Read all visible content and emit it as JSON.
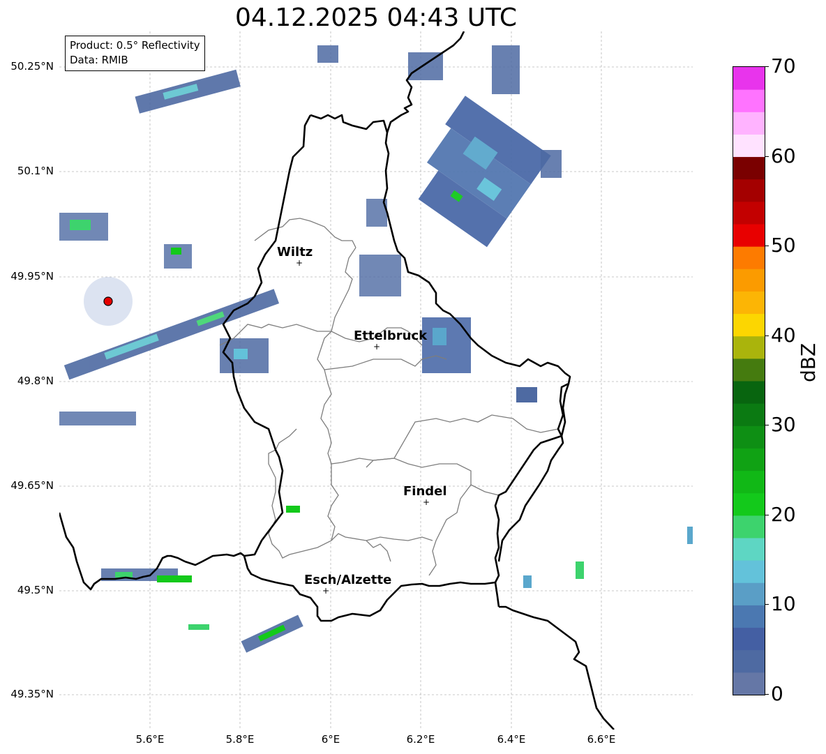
{
  "title": "04.12.2025 04:43 UTC",
  "infobox": {
    "product": "Product: 0.5° Reflectivity",
    "data": "Data: RMIB"
  },
  "axes": {
    "y_ticks": [
      "50.25°N",
      "50.1°N",
      "49.95°N",
      "49.8°N",
      "49.65°N",
      "49.5°N",
      "49.35°N"
    ],
    "x_ticks": [
      "5.6°E",
      "5.8°E",
      "6°E",
      "6.2°E",
      "6.4°E",
      "6.6°E"
    ]
  },
  "cities": [
    {
      "name": "Wiltz"
    },
    {
      "name": "Ettelbruck"
    },
    {
      "name": "Findel"
    },
    {
      "name": "Esch/Alzette"
    }
  ],
  "colorbar": {
    "label": "dBZ",
    "ticks": [
      "0",
      "10",
      "20",
      "30",
      "40",
      "50",
      "60",
      "70"
    ],
    "colors": [
      "#6577a6",
      "#4e6aa2",
      "#445fa3",
      "#4b78b1",
      "#5a9ec6",
      "#63c2da",
      "#5ed6c3",
      "#3dd36d",
      "#13c91b",
      "#11b816",
      "#10a214",
      "#0e8f14",
      "#0b7a12",
      "#08650f",
      "#457b0f",
      "#aab40c",
      "#fcd601",
      "#fcb505",
      "#fb9b00",
      "#fd7b00",
      "#e80000",
      "#c30000",
      "#a40000",
      "#7a0000",
      "#ffe2ff",
      "#ffb3ff",
      "#ff73ff",
      "#e834ec"
    ]
  }
}
